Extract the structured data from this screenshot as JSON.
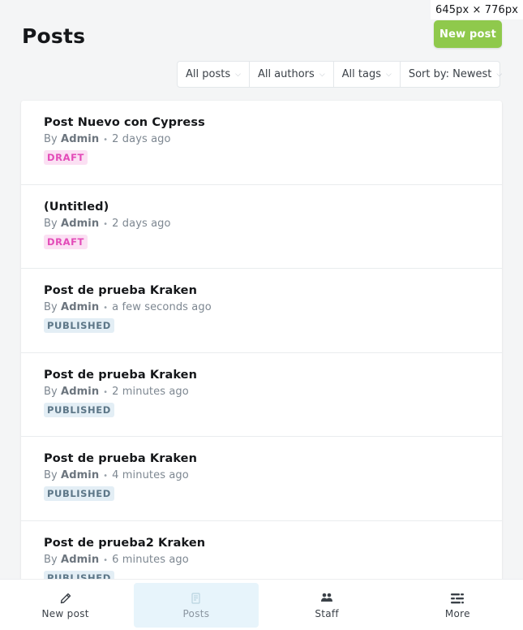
{
  "size_label": "645px × 776px",
  "header": {
    "title": "Posts",
    "new_post_label": "New post"
  },
  "filters": {
    "type": "All posts",
    "author": "All authors",
    "tag": "All tags",
    "sort": "Sort by: Newest"
  },
  "posts": [
    {
      "title": "Post Nuevo con Cypress",
      "by": "By",
      "author": "Admin",
      "time": "2 days ago",
      "status": "DRAFT"
    },
    {
      "title": "(Untitled)",
      "by": "By",
      "author": "Admin",
      "time": "2 days ago",
      "status": "DRAFT"
    },
    {
      "title": "Post de prueba Kraken",
      "by": "By",
      "author": "Admin",
      "time": "a few seconds ago",
      "status": "PUBLISHED"
    },
    {
      "title": "Post de prueba Kraken",
      "by": "By",
      "author": "Admin",
      "time": "2 minutes ago",
      "status": "PUBLISHED"
    },
    {
      "title": "Post de prueba Kraken",
      "by": "By",
      "author": "Admin",
      "time": "4 minutes ago",
      "status": "PUBLISHED"
    },
    {
      "title": "Post de prueba2 Kraken",
      "by": "By",
      "author": "Admin",
      "time": "6 minutes ago",
      "status": "PUBLISHED"
    }
  ],
  "bottom_nav": [
    {
      "label": "New post",
      "icon": "pencil-icon"
    },
    {
      "label": "Posts",
      "icon": "posts-icon",
      "active": true
    },
    {
      "label": "Staff",
      "icon": "staff-icon"
    },
    {
      "label": "More",
      "icon": "more-icon"
    }
  ],
  "colors": {
    "accent_green": "#8fc94c",
    "draft_bg": "#fbe0f3",
    "draft_text": "#e34bb8",
    "published_bg": "#e3eef5",
    "published_text": "#5c7687",
    "active_nav_bg": "#e7f4fb"
  }
}
